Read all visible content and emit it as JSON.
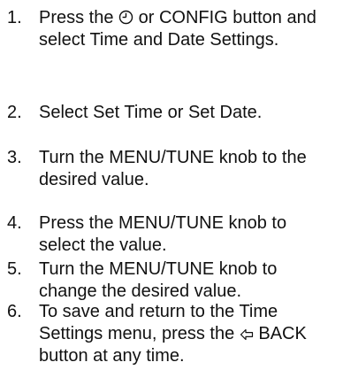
{
  "steps": [
    {
      "number": "1.",
      "text_before_icon": "Press the",
      "icon": "clock-icon",
      "text_after_icon": "or CONFIG button and select Time and Date Settings."
    },
    {
      "number": "2.",
      "text": "Select Set Time or Set Date."
    },
    {
      "number": "3.",
      "text": "Turn the MENU/TUNE knob to the desired value."
    },
    {
      "number": "4.",
      "text": "Press the MENU/TUNE knob to select the value."
    },
    {
      "number": "5.",
      "text": "Turn the MENU/TUNE knob to change the desired value."
    },
    {
      "number": "6.",
      "text_before_icon": "To save and return to the Time Settings menu, press the",
      "icon": "back-arrow-icon",
      "text_after_icon": "BACK button at any time."
    }
  ]
}
